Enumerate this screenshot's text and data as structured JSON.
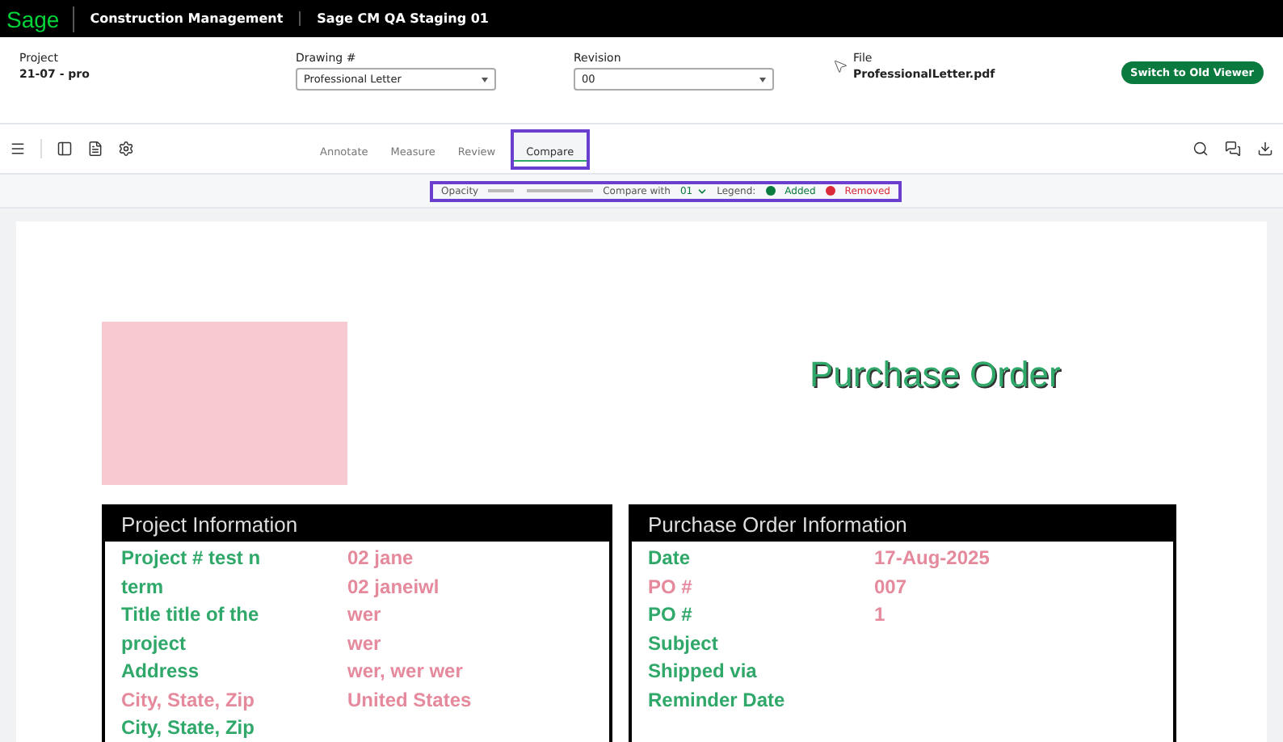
{
  "topbar": {
    "brand": "Sage",
    "product": "Construction Management",
    "site": "Sage CM QA Staging 01"
  },
  "header": {
    "project": {
      "label": "Project",
      "value": "21-07 - pro"
    },
    "drawing": {
      "label": "Drawing #",
      "value": "Professional Letter"
    },
    "revision": {
      "label": "Revision",
      "value": "00"
    },
    "file": {
      "label": "File",
      "value": "ProfessionalLetter.pdf"
    },
    "button": "Switch to Old Viewer"
  },
  "tabs": [
    {
      "label": "Annotate",
      "selected": false
    },
    {
      "label": "Measure",
      "selected": false
    },
    {
      "label": "Review",
      "selected": false
    },
    {
      "label": "Compare",
      "selected": true
    }
  ],
  "compare_bar": {
    "opacity_label": "Opacity",
    "opacity": {
      "level": 0.3
    },
    "compare_label": "Compare with",
    "compare_value": "01",
    "legend_label": "Legend:",
    "legend": [
      {
        "label": "Added",
        "color": "#0b7a3e"
      },
      {
        "label": "Removed",
        "color": "#d92b3a"
      }
    ]
  },
  "document": {
    "title": "Purchase Order",
    "tables": [
      {
        "heading": "Project Information",
        "labels": [
          {
            "text": "Project # test n",
            "kind": "added"
          },
          {
            "text": "term",
            "kind": "added"
          },
          {
            "text": "Title title of the",
            "kind": "added"
          },
          {
            "text": "project",
            "kind": "added"
          },
          {
            "text": "Address",
            "kind": "added"
          },
          {
            "text": "City, State, Zip",
            "kind": "removed"
          },
          {
            "text": "City, State, Zip",
            "kind": "added"
          }
        ],
        "values": [
          {
            "text": "02 jane",
            "kind": "removed"
          },
          {
            "text": "02 janeiwl",
            "kind": "removed"
          },
          {
            "text": "wer",
            "kind": "removed"
          },
          {
            "text": "wer",
            "kind": "removed"
          },
          {
            "text": "wer, wer wer",
            "kind": "removed"
          },
          {
            "text": "United States",
            "kind": "removed"
          }
        ]
      },
      {
        "heading": "Purchase Order Information",
        "labels": [
          {
            "text": "Date",
            "kind": "added"
          },
          {
            "text": "PO #",
            "kind": "removed"
          },
          {
            "text": "PO #",
            "kind": "added"
          },
          {
            "text": "Subject",
            "kind": "added"
          },
          {
            "text": "Shipped via",
            "kind": "added"
          },
          {
            "text": "Reminder Date",
            "kind": "added"
          }
        ],
        "values": [
          {
            "text": "17-Aug-2025",
            "kind": "removed"
          },
          {
            "text": "007",
            "kind": "removed"
          },
          {
            "text": "1",
            "kind": "removed"
          }
        ]
      }
    ]
  }
}
